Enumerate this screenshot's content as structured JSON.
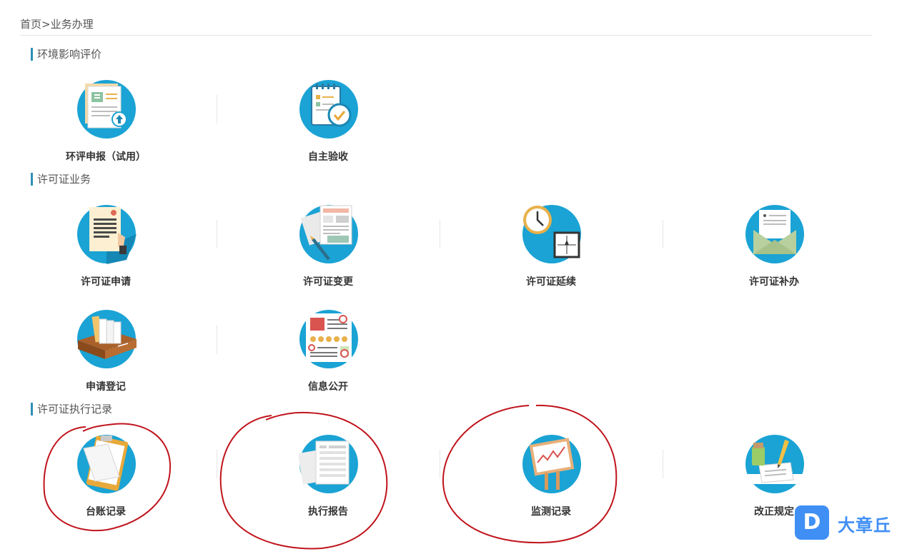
{
  "breadcrumb": {
    "home": "首页",
    "separator": ">",
    "current": "业务办理"
  },
  "sections": [
    {
      "title": "环境影响评价",
      "items": [
        {
          "label": "环评申报（试用）",
          "icon": "eia-report-upload-icon"
        },
        {
          "label": "自主验收",
          "icon": "self-acceptance-checklist-icon"
        }
      ]
    },
    {
      "title": "许可证业务",
      "items": [
        {
          "label": "许可证申请",
          "icon": "license-application-icon"
        },
        {
          "label": "许可证变更",
          "icon": "license-change-icon"
        },
        {
          "label": "许可证延续",
          "icon": "license-renewal-clock-icon"
        },
        {
          "label": "许可证补办",
          "icon": "license-reissue-envelope-icon"
        },
        {
          "label": "申请登记",
          "icon": "application-registration-books-icon"
        },
        {
          "label": "信息公开",
          "icon": "information-disclosure-icon"
        }
      ]
    },
    {
      "title": "许可证执行记录",
      "items": [
        {
          "label": "台账记录",
          "icon": "ledger-clipboard-icon"
        },
        {
          "label": "执行报告",
          "icon": "execution-report-icon"
        },
        {
          "label": "监测记录",
          "icon": "monitoring-chart-icon"
        },
        {
          "label": "改正规定",
          "icon": "correction-rules-icon"
        }
      ]
    }
  ],
  "watermark": {
    "logo_letter": "D",
    "text": "大章丘"
  },
  "colors": {
    "icon_circle": "#1aa3d4",
    "section_bar": "#2f8fb5",
    "annotation_red": "#c0141c",
    "watermark_blue": "#3f8ff5"
  }
}
